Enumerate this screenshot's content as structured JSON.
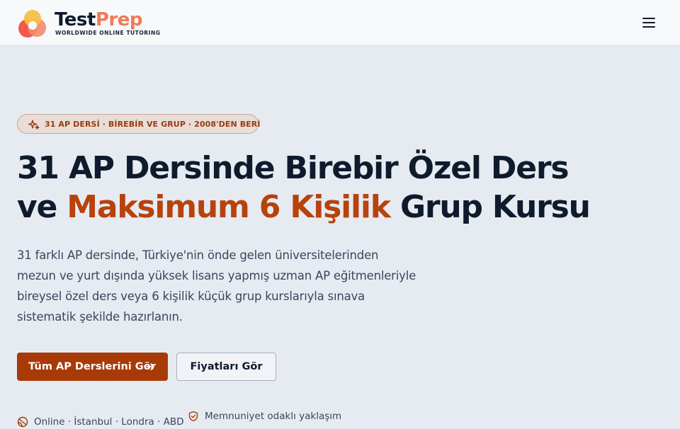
{
  "header": {
    "logo_name_part1": "Test",
    "logo_name_part2": "Prep",
    "logo_tagline": "WORLDWIDE ONLINE TUTORING",
    "menu_icon": "hamburger-menu-icon"
  },
  "hero": {
    "badge": {
      "icon": "sparkle-icon",
      "text": "31 AP DERSİ · BİREBİR VE GRUP · 2008'DEN BERİ"
    },
    "headline": {
      "part1": "31 AP Dersinde Birebir Özel Ders",
      "part2": "ve",
      "accent": "Maksimum 6 Kişilik",
      "part3": "Grup Kursu"
    },
    "description": "31 farklı AP dersinde, Türkiye'nin önde gelen üniversitelerinden mezun ve yurt dışında yüksek lisans yapmış uzman AP eğitmenleriyle bireysel özel ders veya 6 kişilik küçük grup kurslarıyla sınava sistematik şekilde hazırlanın.",
    "primary_button": "Tüm AP Derslerini Gör",
    "secondary_button": "Fiyatları Gör",
    "features": [
      {
        "icon": "globe-icon",
        "text": "Online · İstanbul · Londra · ABD"
      },
      {
        "icon": "shield-check-icon",
        "text": "Memnuniyet odaklı yaklaşım"
      }
    ]
  },
  "colors": {
    "accent": "#b8420c",
    "primary_button": "#a83a08",
    "navy": "#0f1b2d",
    "background": "#e6ebf2",
    "logo_orange": "#f07a5a"
  }
}
